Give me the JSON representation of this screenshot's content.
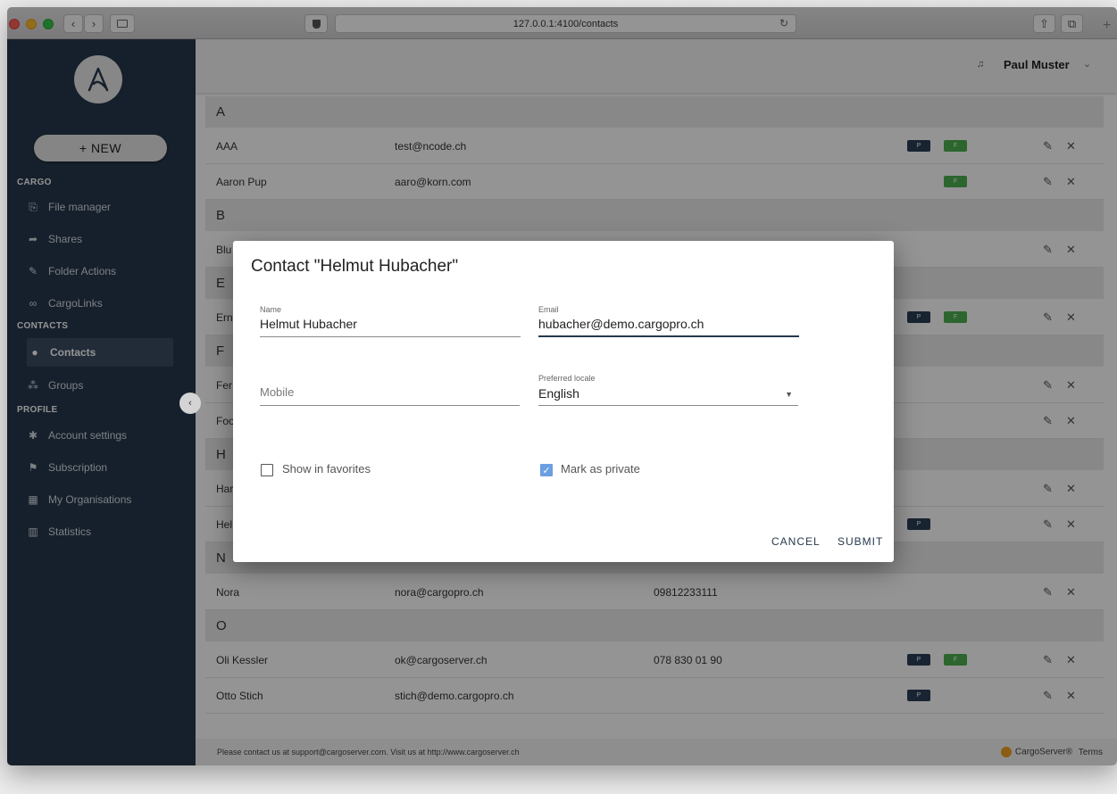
{
  "browser": {
    "url": "127.0.0.1:4100/contacts",
    "nav_back": "‹",
    "nav_forward": "›"
  },
  "sidebar": {
    "new_label": "+ NEW",
    "sections": {
      "cargo": "CARGO",
      "contacts": "CONTACTS",
      "profile": "PROFILE"
    },
    "items": [
      {
        "label": "File manager",
        "icon": "file-manager-icon"
      },
      {
        "label": "Shares",
        "icon": "share-icon"
      },
      {
        "label": "Folder Actions",
        "icon": "folder-actions-icon"
      },
      {
        "label": "CargoLinks",
        "icon": "link-icon"
      },
      {
        "label": "Contacts",
        "icon": "contact-icon",
        "active": true
      },
      {
        "label": "Groups",
        "icon": "groups-icon"
      },
      {
        "label": "Account settings",
        "icon": "gear-icon"
      },
      {
        "label": "Subscription",
        "icon": "flag-icon"
      },
      {
        "label": "My Organisations",
        "icon": "building-icon"
      },
      {
        "label": "Statistics",
        "icon": "chart-icon"
      }
    ]
  },
  "header": {
    "user_name": "Paul Muster"
  },
  "contacts": {
    "groups": [
      {
        "letter": "A",
        "rows": [
          {
            "name": "AAA",
            "email": "test@ncode.ch",
            "phone": "",
            "p": true,
            "f": true
          },
          {
            "name": "Aaron Pup",
            "email": "aaro@korn.com",
            "phone": "",
            "p": false,
            "f": true
          }
        ]
      },
      {
        "letter": "B",
        "rows": [
          {
            "name": "Blu",
            "email": "",
            "phone": "",
            "p": false,
            "f": false
          }
        ]
      },
      {
        "letter": "E",
        "rows": [
          {
            "name": "Ern",
            "email": "",
            "phone": "",
            "p": true,
            "f": true
          }
        ]
      },
      {
        "letter": "F",
        "rows": [
          {
            "name": "Fer",
            "email": "",
            "phone": "",
            "p": false,
            "f": false
          },
          {
            "name": "Foo",
            "email": "",
            "phone": "",
            "p": false,
            "f": false
          }
        ]
      },
      {
        "letter": "H",
        "rows": [
          {
            "name": "Har",
            "email": "",
            "phone": "",
            "p": false,
            "f": false
          },
          {
            "name": "Hel",
            "email": "",
            "phone": "",
            "p": true,
            "f": false
          }
        ]
      },
      {
        "letter": "N",
        "rows": [
          {
            "name": "Nora",
            "email": "nora@cargopro.ch",
            "phone": "09812233111",
            "p": false,
            "f": false
          }
        ]
      },
      {
        "letter": "O",
        "rows": [
          {
            "name": "Oli Kessler",
            "email": "ok@cargoserver.ch",
            "phone": "078 830 01 90",
            "p": true,
            "f": true
          },
          {
            "name": "Otto Stich",
            "email": "stich@demo.cargopro.ch",
            "phone": "",
            "p": true,
            "f": false
          }
        ]
      }
    ],
    "badge_p": "P",
    "badge_f": "F"
  },
  "footer": {
    "text": "Please contact us at support@cargoserver.com. Visit us at http://www.cargoserver.ch",
    "brand": "CargoServer®",
    "terms": "Terms"
  },
  "dialog": {
    "title": "Contact \"Helmut Hubacher\"",
    "name_label": "Name",
    "name_value": "Helmut Hubacher",
    "email_label": "Email",
    "email_value": "hubacher@demo.cargopro.ch",
    "mobile_placeholder": "Mobile",
    "locale_label": "Preferred locale",
    "locale_value": "English",
    "favorites_label": "Show in favorites",
    "favorites_checked": false,
    "private_label": "Mark as private",
    "private_checked": true,
    "cancel_label": "CANCEL",
    "submit_label": "SUBMIT"
  }
}
